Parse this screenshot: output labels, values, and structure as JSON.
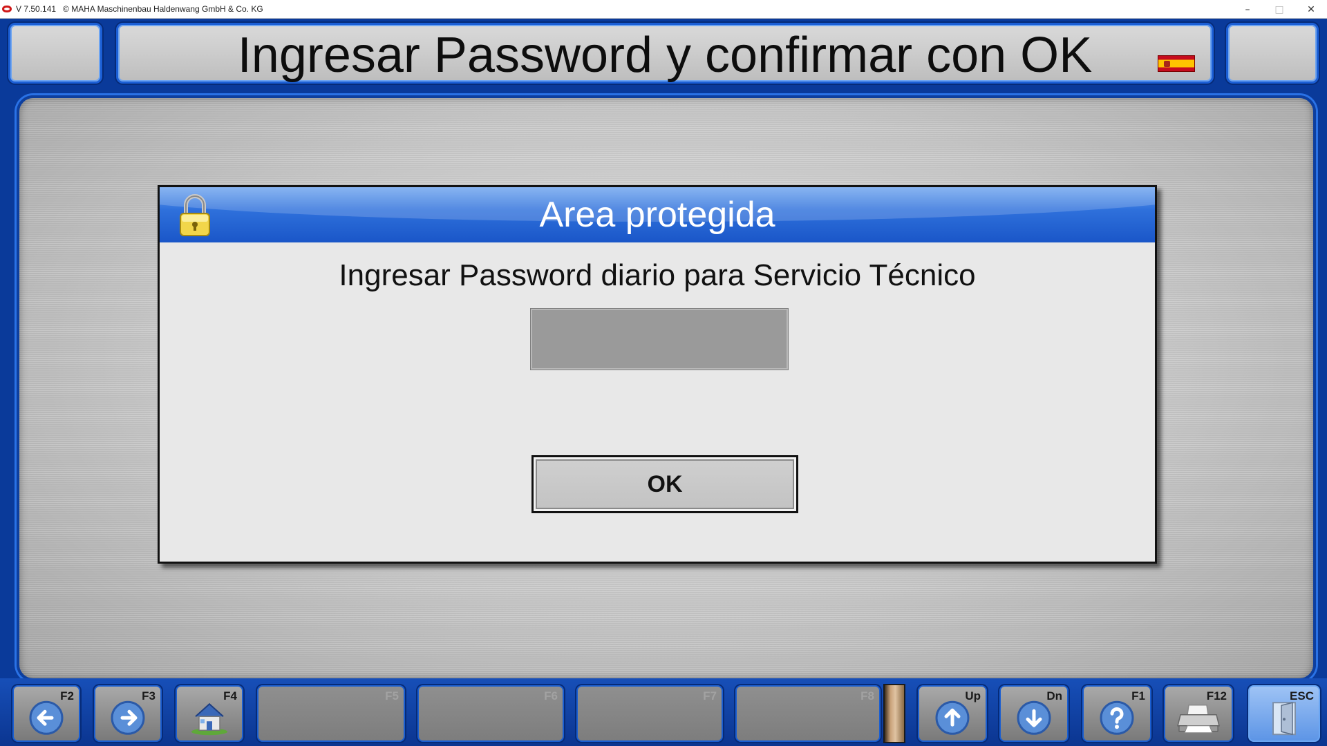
{
  "window": {
    "title_text": "V 7.50.141   © MAHA Maschinenbau Haldenwang GmbH & Co. KG",
    "controls": {
      "minimize": "–",
      "maximize": "□",
      "close": "✕"
    }
  },
  "header": {
    "title": "Ingresar Password y confirmar con OK",
    "language_flag": "flag-es-icon"
  },
  "dialog": {
    "title": "Area protegida",
    "message": "Ingresar Password diario para Servicio Técnico",
    "password_value": "",
    "ok_label": "OK"
  },
  "function_keys": [
    {
      "label": "F2",
      "icon": "arrow-left-icon"
    },
    {
      "label": "F3",
      "icon": "arrow-right-icon"
    },
    {
      "label": "F4",
      "icon": "home-icon"
    },
    {
      "label": "F5",
      "icon": ""
    },
    {
      "label": "F6",
      "icon": ""
    },
    {
      "label": "F7",
      "icon": ""
    },
    {
      "label": "F8",
      "icon": ""
    },
    {
      "label": "Up",
      "icon": "arrow-up-icon"
    },
    {
      "label": "Dn",
      "icon": "arrow-down-icon"
    },
    {
      "label": "F1",
      "icon": "help-icon"
    },
    {
      "label": "F12",
      "icon": "printer-icon"
    },
    {
      "label": "ESC",
      "icon": "exit-door-icon"
    }
  ],
  "colors": {
    "frame_blue": "#1b5fd6",
    "dialog_header_blue": "#2f71dc",
    "panel_gray": "#c9c9c9"
  }
}
